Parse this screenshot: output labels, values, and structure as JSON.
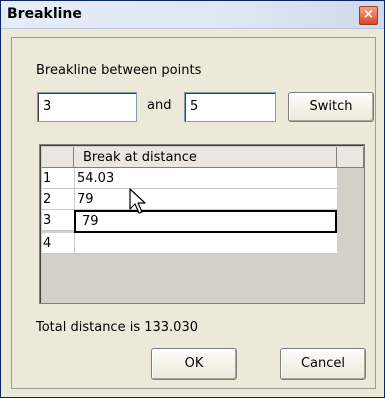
{
  "window": {
    "title": "Breakline",
    "close_glyph": "×"
  },
  "form": {
    "prompt": "Breakline between points",
    "point_a": "3",
    "and_label": "and",
    "point_b": "5",
    "switch_label": "Switch"
  },
  "grid": {
    "column_header": "Break at distance",
    "rows": [
      {
        "num": "1",
        "value": "54.03"
      },
      {
        "num": "2",
        "value": "79"
      },
      {
        "num": "3",
        "value": "79"
      },
      {
        "num": "4",
        "value": ""
      }
    ],
    "active_row": "3"
  },
  "footer": {
    "total": "Total distance is 133.030",
    "ok_label": "OK",
    "cancel_label": "Cancel"
  }
}
